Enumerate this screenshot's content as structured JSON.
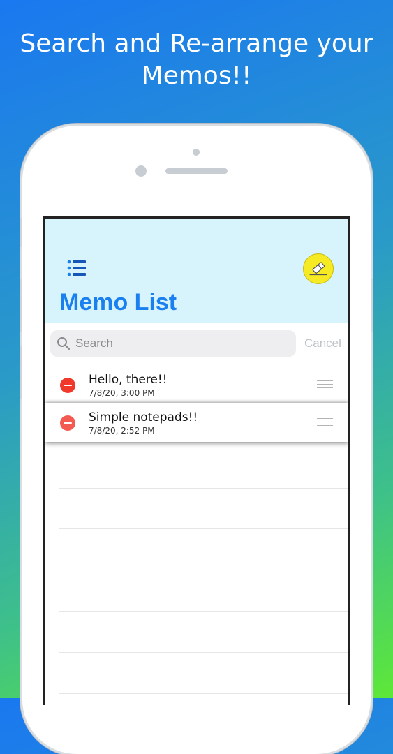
{
  "promo": {
    "headline": "Search and Re-arrange your Memos!!"
  },
  "app": {
    "title": "Memo List",
    "list_icon": "list-icon",
    "compose_icon": "compose-icon",
    "accent_color": "#1a80ef",
    "nav_background": "#d7f3fc",
    "compose_color": "#f6ea22"
  },
  "search": {
    "placeholder": "Search",
    "cancel_label": "Cancel",
    "icon": "search-icon"
  },
  "memos": [
    {
      "title": "Hello, there!!",
      "date": "7/8/20, 3:00 PM"
    },
    {
      "title": "Simple notepads!!",
      "date": "7/8/20, 2:52 PM"
    }
  ],
  "row_controls": {
    "delete_icon": "minus-circle-icon",
    "reorder_icon": "drag-handle-icon",
    "delete_color": "#f0382b"
  }
}
